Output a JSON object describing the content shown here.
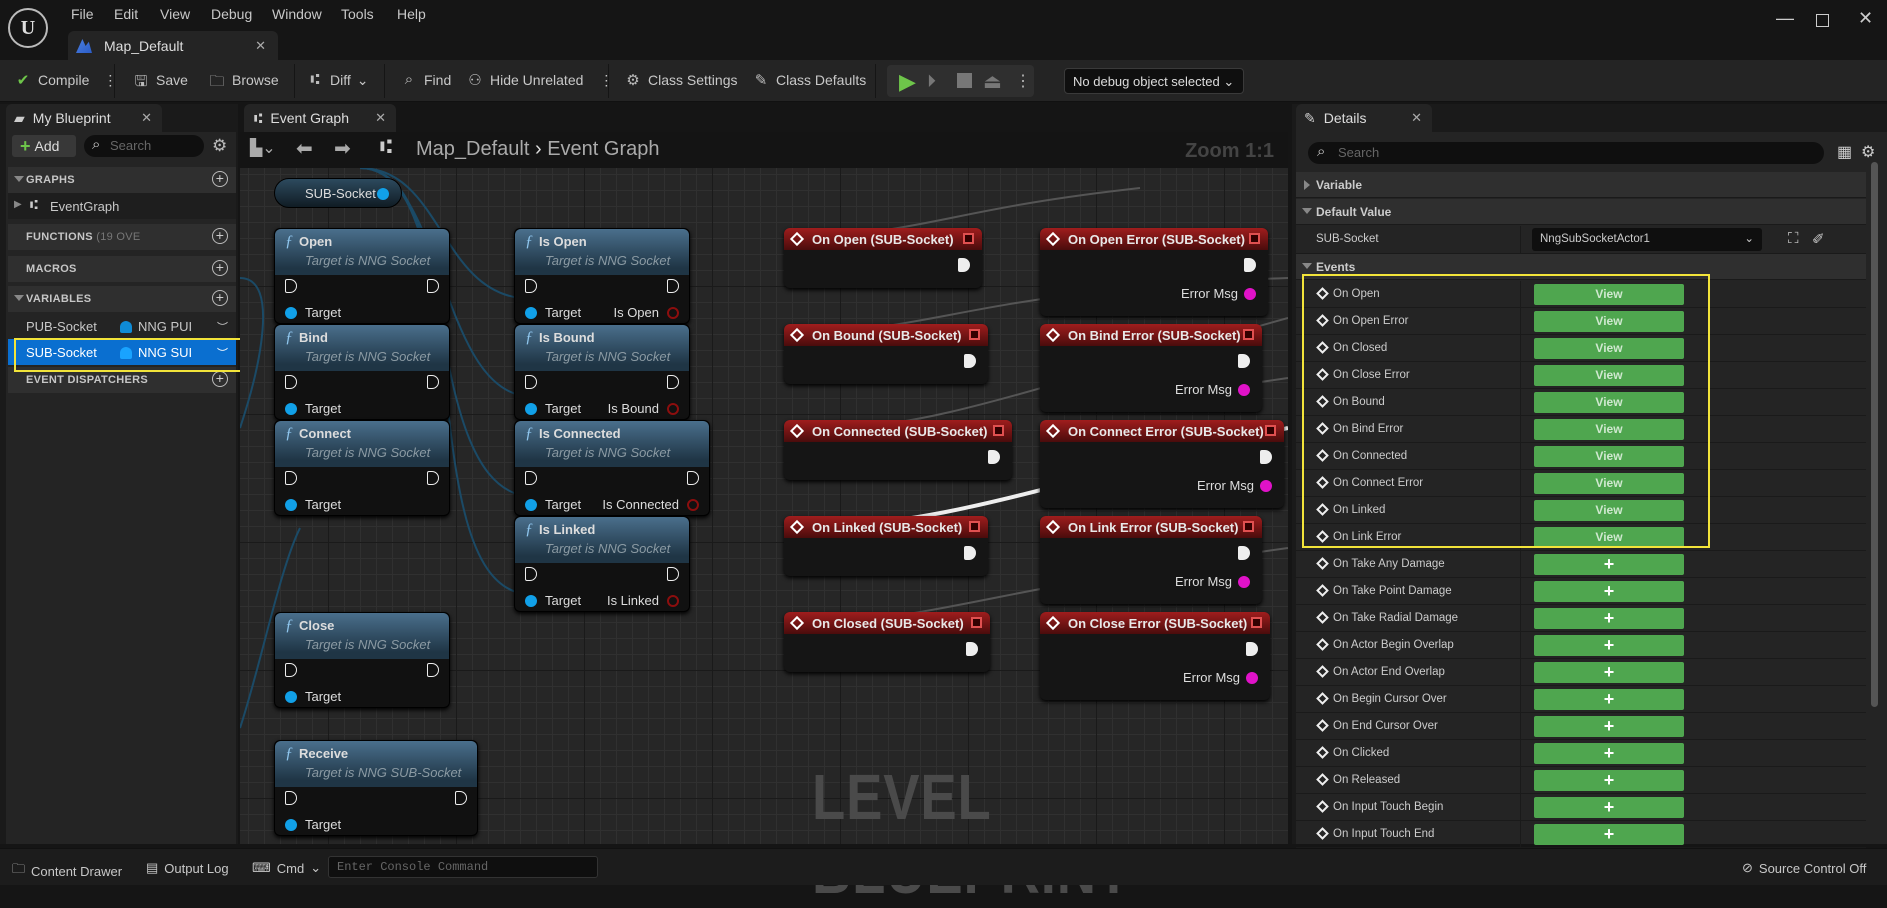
{
  "app": {
    "menu": [
      "File",
      "Edit",
      "View",
      "Debug",
      "Window",
      "Tools",
      "Help"
    ],
    "doc_tab": "Map_Default"
  },
  "toolbar": {
    "compile": "Compile",
    "save": "Save",
    "browse": "Browse",
    "diff": "Diff",
    "find": "Find",
    "hide_unrelated": "Hide Unrelated",
    "class_settings": "Class Settings",
    "class_defaults": "Class Defaults",
    "debug_object": "No debug object selected"
  },
  "my_blueprint": {
    "tab": "My Blueprint",
    "add": "Add",
    "search_placeholder": "Search",
    "sections": {
      "graphs": "GRAPHS",
      "event_graph": "EventGraph",
      "functions": "FUNCTIONS",
      "functions_note": "(19 OVE",
      "macros": "MACROS",
      "variables": "VARIABLES",
      "event_dispatchers": "EVENT DISPATCHERS"
    },
    "variables": [
      {
        "name": "PUB-Socket",
        "type": "NNG PUI"
      },
      {
        "name": "SUB-Socket",
        "type": "NNG SUI",
        "selected": true
      }
    ]
  },
  "graph": {
    "tab": "Event Graph",
    "breadcrumb": [
      "Map_Default",
      "Event Graph"
    ],
    "zoom": "Zoom 1:1",
    "watermark": "LEVEL BLUEPRINT",
    "get_node": "SUB-Socket",
    "target_label": "Target",
    "functions": [
      {
        "title": "Open",
        "sub": "Target is NNG Socket"
      },
      {
        "title": "Bind",
        "sub": "Target is NNG Socket"
      },
      {
        "title": "Connect",
        "sub": "Target is NNG Socket"
      },
      {
        "title": "Close",
        "sub": "Target is NNG Socket"
      },
      {
        "title": "Receive",
        "sub": "Target is NNG SUB-Socket"
      },
      {
        "title": "Is Open",
        "sub": "Target is NNG Socket",
        "out": "Is Open"
      },
      {
        "title": "Is Bound",
        "sub": "Target is NNG Socket",
        "out": "Is Bound"
      },
      {
        "title": "Is Connected",
        "sub": "Target is NNG Socket",
        "out": "Is Connected"
      },
      {
        "title": "Is Linked",
        "sub": "Target is NNG Socket",
        "out": "Is Linked"
      }
    ],
    "events": [
      {
        "title": "On Open (SUB-Socket)"
      },
      {
        "title": "On Bound (SUB-Socket)"
      },
      {
        "title": "On Connected (SUB-Socket)"
      },
      {
        "title": "On Linked (SUB-Socket)"
      },
      {
        "title": "On Closed (SUB-Socket)"
      },
      {
        "title": "On Open Error (SUB-Socket)",
        "out": "Error Msg"
      },
      {
        "title": "On Bind Error (SUB-Socket)",
        "out": "Error Msg"
      },
      {
        "title": "On Connect Error (SUB-Socket)",
        "out": "Error Msg"
      },
      {
        "title": "On Link Error (SUB-Socket)",
        "out": "Error Msg"
      },
      {
        "title": "On Close Error (SUB-Socket)",
        "out": "Error Msg"
      }
    ]
  },
  "details": {
    "tab": "Details",
    "search_placeholder": "Search",
    "sections": {
      "variable": "Variable",
      "default_value": "Default Value",
      "events": "Events"
    },
    "default_value": {
      "label": "SUB-Socket",
      "value": "NngSubSocketActor1"
    },
    "bound_events": [
      {
        "label": "On Open",
        "button": "View"
      },
      {
        "label": "On Open Error",
        "button": "View"
      },
      {
        "label": "On Closed",
        "button": "View"
      },
      {
        "label": "On Close Error",
        "button": "View"
      },
      {
        "label": "On Bound",
        "button": "View"
      },
      {
        "label": "On Bind Error",
        "button": "View"
      },
      {
        "label": "On Connected",
        "button": "View"
      },
      {
        "label": "On Connect Error",
        "button": "View"
      },
      {
        "label": "On Linked",
        "button": "View"
      },
      {
        "label": "On Link Error",
        "button": "View"
      }
    ],
    "unbound_events": [
      {
        "label": "On Take Any Damage",
        "button": "+"
      },
      {
        "label": "On Take Point Damage",
        "button": "+"
      },
      {
        "label": "On Take Radial Damage",
        "button": "+"
      },
      {
        "label": "On Actor Begin Overlap",
        "button": "+"
      },
      {
        "label": "On Actor End Overlap",
        "button": "+"
      },
      {
        "label": "On Begin Cursor Over",
        "button": "+"
      },
      {
        "label": "On End Cursor Over",
        "button": "+"
      },
      {
        "label": "On Clicked",
        "button": "+"
      },
      {
        "label": "On Released",
        "button": "+"
      },
      {
        "label": "On Input Touch Begin",
        "button": "+"
      },
      {
        "label": "On Input Touch End",
        "button": "+"
      }
    ]
  },
  "statusbar": {
    "content_drawer": "Content Drawer",
    "output_log": "Output Log",
    "cmd": "Cmd",
    "console_placeholder": "Enter Console Command",
    "source_control": "Source Control Off"
  }
}
